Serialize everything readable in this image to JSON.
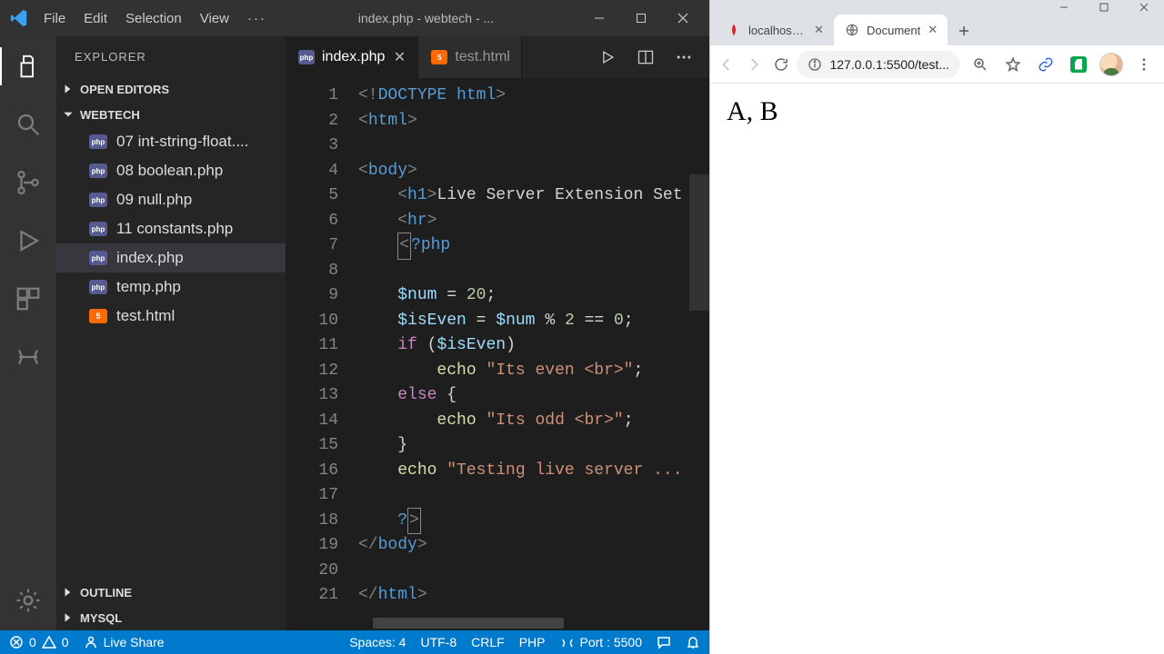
{
  "vscode": {
    "menu": [
      "File",
      "Edit",
      "Selection",
      "View"
    ],
    "menu_more": "···",
    "window_title": "index.php - webtech - ...",
    "explorer_label": "EXPLORER",
    "sections": {
      "open_editors": "OPEN EDITORS",
      "folder": "WEBTECH",
      "outline": "OUTLINE",
      "mysql": "MYSQL"
    },
    "files": [
      {
        "name": "07 int-string-float....",
        "type": "php"
      },
      {
        "name": "08 boolean.php",
        "type": "php"
      },
      {
        "name": "09 null.php",
        "type": "php"
      },
      {
        "name": "11 constants.php",
        "type": "php"
      },
      {
        "name": "index.php",
        "type": "php",
        "active": true
      },
      {
        "name": "temp.php",
        "type": "php"
      },
      {
        "name": "test.html",
        "type": "html"
      }
    ],
    "tabs": [
      {
        "name": "index.php",
        "type": "php",
        "active": true,
        "close": true
      },
      {
        "name": "test.html",
        "type": "html",
        "active": false,
        "close": false
      }
    ],
    "code_lines": 21,
    "status": {
      "errors": "0",
      "warnings": "0",
      "liveshare": "Live Share",
      "spaces": "Spaces: 4",
      "encoding": "UTF-8",
      "eol": "CRLF",
      "lang": "PHP",
      "port": "Port : 5500"
    }
  },
  "chrome": {
    "tabs": [
      {
        "label": "localhost/we",
        "active": false,
        "icon": "apache"
      },
      {
        "label": "Document",
        "active": true,
        "icon": "globe"
      }
    ],
    "url_prefix_icon": "info",
    "url": "127.0.0.1:5500/test...",
    "page_text": "A, B"
  }
}
